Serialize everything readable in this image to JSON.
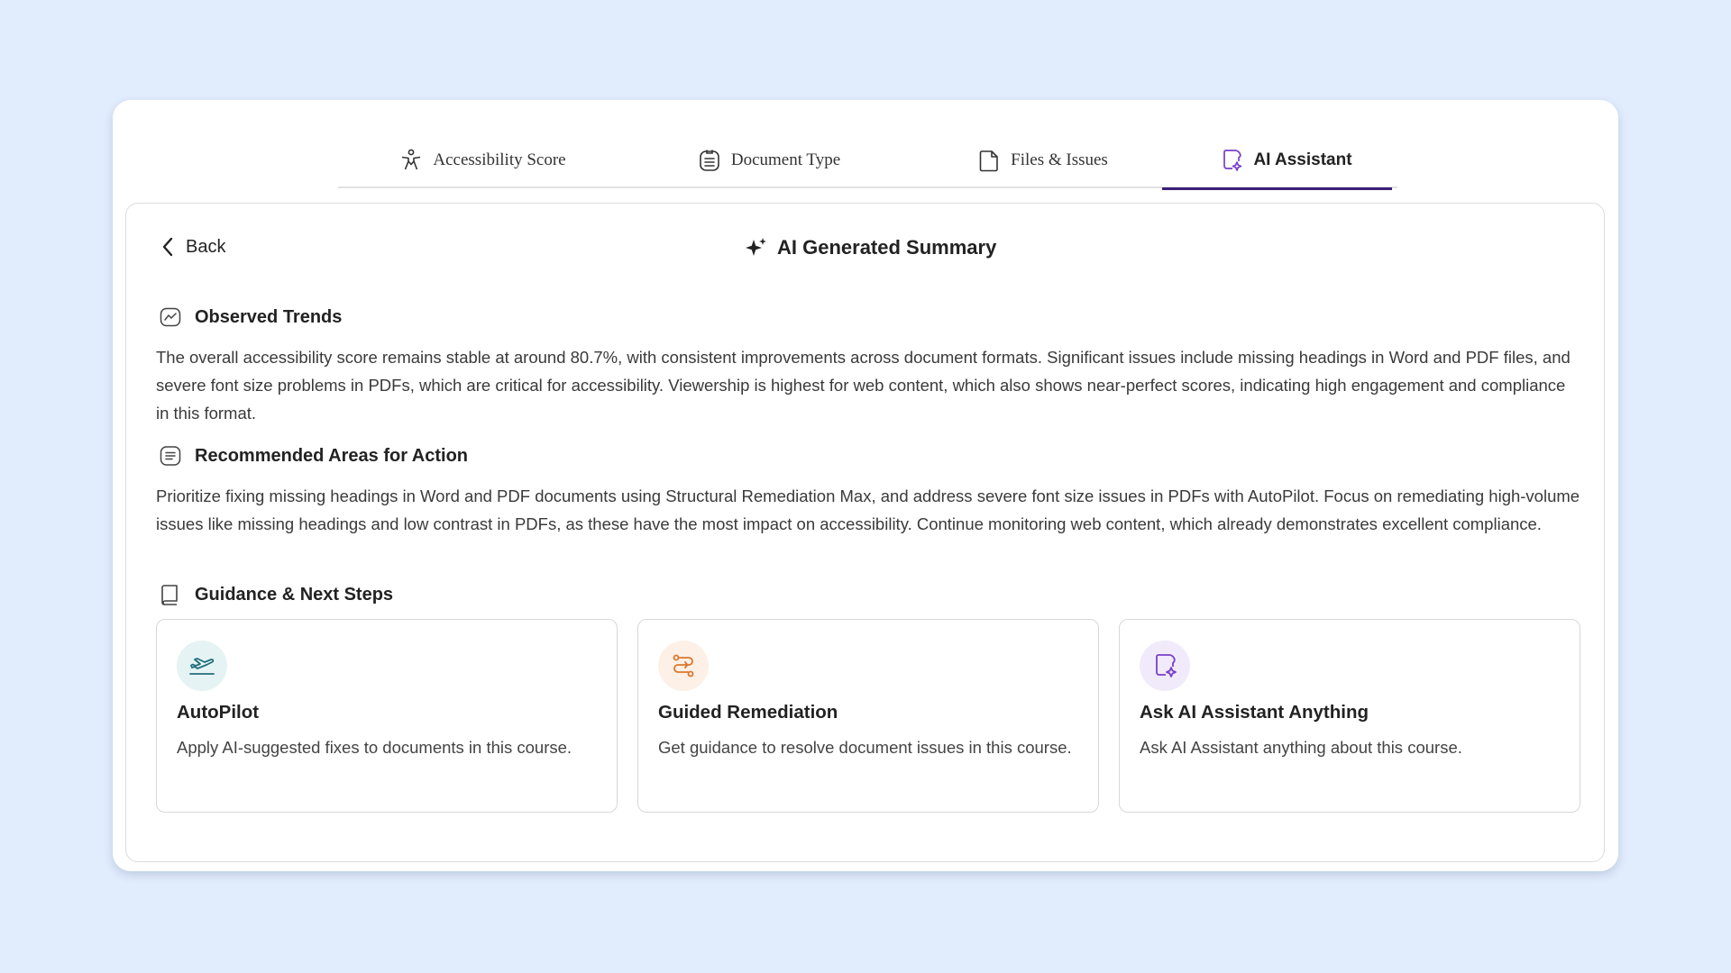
{
  "tabs": [
    {
      "label": "Accessibility Score",
      "icon": "accessibility-icon"
    },
    {
      "label": "Document Type",
      "icon": "document-list-icon"
    },
    {
      "label": "Files & Issues",
      "icon": "file-icon"
    },
    {
      "label": "AI Assistant",
      "icon": "ai-assistant-icon",
      "active": true
    }
  ],
  "nav": {
    "back_label": "Back"
  },
  "summary": {
    "title": "AI Generated Summary",
    "icon": "sparkles-icon"
  },
  "sections": [
    {
      "title": "Observed Trends",
      "icon": "trend-icon",
      "body": "The overall accessibility score remains stable at around 80.7%, with consistent improvements across document formats. Significant issues include missing headings in Word and PDF files, and severe font size problems in PDFs, which are critical for accessibility. Viewership is highest for web content, which also shows near-perfect scores, indicating high engagement and compliance in this format."
    },
    {
      "title": "Recommended Areas for Action",
      "icon": "list-icon",
      "body": "Prioritize fixing missing headings in Word and PDF documents using Structural Remediation Max, and address severe font size issues in PDFs with AutoPilot. Focus on remediating high-volume issues like missing headings and low contrast in PDFs, as these have the most impact on accessibility. Continue monitoring web content, which already demonstrates excellent compliance."
    },
    {
      "title": "Guidance & Next Steps",
      "icon": "book-icon"
    }
  ],
  "cards": [
    {
      "title": "AutoPilot",
      "description": "Apply AI-suggested fixes to documents in this course.",
      "icon": "airplane-icon",
      "icon_bg": "#e6f3f4",
      "icon_color": "#1f6f7a"
    },
    {
      "title": "Guided Remediation",
      "description": "Get guidance to resolve document issues in this course.",
      "icon": "route-icon",
      "icon_bg": "#fdf0e6",
      "icon_color": "#d9772b"
    },
    {
      "title": "Ask AI Assistant Anything",
      "description": "Ask AI Assistant anything about this course.",
      "icon": "ai-assistant-icon",
      "icon_bg": "#f1eafb",
      "icon_color": "#7a3fc8"
    }
  ],
  "colors": {
    "background": "#e1ecfd",
    "active_tab_underline": "#3b1f7a",
    "ai_purple": "#7a3fc8"
  }
}
